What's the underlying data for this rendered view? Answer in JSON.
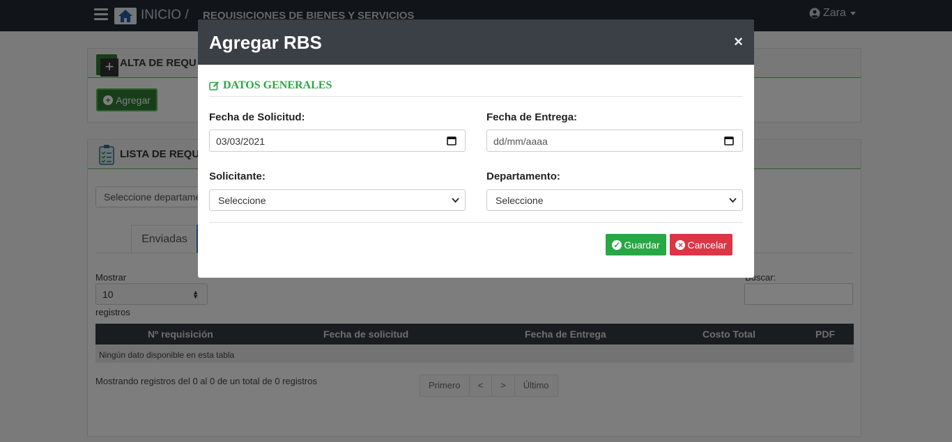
{
  "navbar": {
    "inicio": "INICIO /",
    "title": "REQUISICIONES DE BIENES Y SERVICIOS",
    "user": "Zara"
  },
  "background": {
    "alta_title": "ALTA DE REQU",
    "agregar_button": "Agregar",
    "lista_title": "LISTA DE REQU",
    "departamento_select": "Seleccione departame",
    "tab_enviadas": "Enviadas",
    "mostrar_label": "Mostrar",
    "mostrar_value": "10",
    "registros_label": "registros",
    "buscar_label": "Buscar:",
    "table_headers": [
      "Nº requisición",
      "Fecha de solicitud",
      "Fecha de Entrega",
      "Costo Total",
      "PDF"
    ],
    "empty_message": "Ningún dato disponible en esta tabla",
    "info": "Mostrando registros del 0 al 0 de un total de 0 registros",
    "pager": [
      "Primero",
      "<",
      ">",
      "Último"
    ]
  },
  "modal": {
    "title": "Agregar RBS",
    "close": "×",
    "section": "DATOS GENERALES",
    "fecha_solicitud_label": "Fecha de Solicitud:",
    "fecha_solicitud_value": "03/03/2021",
    "fecha_entrega_label": "Fecha de Entrega:",
    "fecha_entrega_placeholder": "dd/mm/aaaa",
    "solicitante_label": "Solicitante:",
    "solicitante_value": "Seleccione",
    "departamento_label": "Departamento:",
    "departamento_value": "Seleccione",
    "guardar": "Guardar",
    "cancelar": "Cancelar"
  },
  "colors": {
    "navbar": "#222a33",
    "modal_header": "#3b4046",
    "success": "#28a745",
    "danger": "#dc3545"
  }
}
